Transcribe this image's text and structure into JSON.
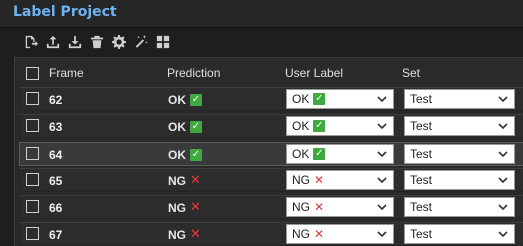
{
  "window": {
    "title": "Label Project"
  },
  "toolbar": {
    "tools": [
      {
        "icon": "export-file-icon"
      },
      {
        "icon": "upload-icon"
      },
      {
        "icon": "download-icon"
      },
      {
        "icon": "trash-icon"
      },
      {
        "icon": "gear-icon"
      },
      {
        "icon": "magic-wand-icon"
      },
      {
        "icon": "grid-icon"
      }
    ]
  },
  "table": {
    "columns": [
      "Frame",
      "Prediction",
      "User Label",
      "Set"
    ],
    "rows": [
      {
        "frame": "62",
        "prediction": "OK",
        "user_label": "OK",
        "set": "Test",
        "selected": false
      },
      {
        "frame": "63",
        "prediction": "OK",
        "user_label": "OK",
        "set": "Test",
        "selected": false
      },
      {
        "frame": "64",
        "prediction": "OK",
        "user_label": "OK",
        "set": "Test",
        "selected": true
      },
      {
        "frame": "65",
        "prediction": "NG",
        "user_label": "NG",
        "set": "Test",
        "selected": false
      },
      {
        "frame": "66",
        "prediction": "NG",
        "user_label": "NG",
        "set": "Test",
        "selected": false
      },
      {
        "frame": "67",
        "prediction": "NG",
        "user_label": "NG",
        "set": "Test",
        "selected": false
      }
    ]
  },
  "colors": {
    "title": "#6fb2f2",
    "ok": "#3fa83f",
    "ng": "#e03a3a"
  }
}
